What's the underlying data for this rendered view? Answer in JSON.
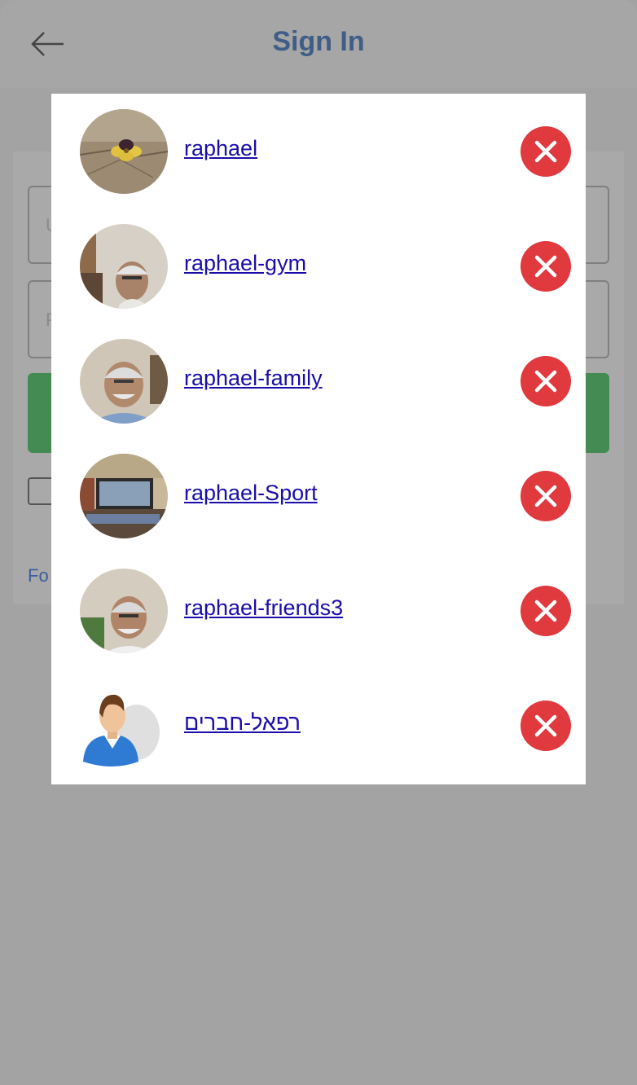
{
  "header": {
    "title": "Sign In"
  },
  "form": {
    "username_placeholder": "U",
    "password_placeholder": "P",
    "forgot_label": "Fo"
  },
  "accounts": [
    {
      "name": "raphael",
      "avatar": "flower-photo"
    },
    {
      "name": "raphael-gym",
      "avatar": "man-photo"
    },
    {
      "name": "raphael-family",
      "avatar": "man-photo"
    },
    {
      "name": "raphael-Sport",
      "avatar": "room-photo"
    },
    {
      "name": "raphael-friends3",
      "avatar": "man-photo"
    },
    {
      "name": "רפאל-חברים",
      "avatar": "default-user-icon"
    }
  ],
  "colors": {
    "overlay": "#a3a3a3",
    "title": "#3f5d86",
    "link": "#1a0dab",
    "remove": "#e0393e",
    "signin_button": "#438b52"
  },
  "icons": {
    "back": "arrow-left-icon",
    "remove": "close-icon"
  }
}
